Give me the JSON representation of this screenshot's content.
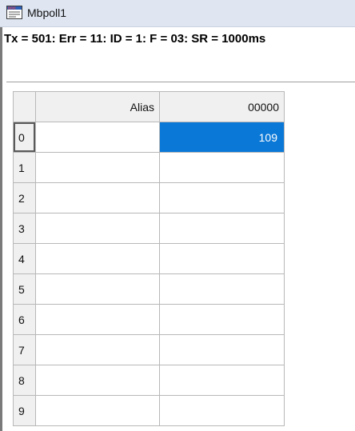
{
  "window": {
    "title": "Mbpoll1",
    "icon": "doc-window-icon"
  },
  "status": {
    "text": "Tx = 501: Err = 11: ID = 1: F = 03: SR = 1000ms"
  },
  "table": {
    "headers": {
      "alias": "Alias",
      "address": "00000"
    },
    "rows": [
      {
        "index": "0",
        "alias": "",
        "value": "109"
      },
      {
        "index": "1",
        "alias": "",
        "value": ""
      },
      {
        "index": "2",
        "alias": "",
        "value": ""
      },
      {
        "index": "3",
        "alias": "",
        "value": ""
      },
      {
        "index": "4",
        "alias": "",
        "value": ""
      },
      {
        "index": "5",
        "alias": "",
        "value": ""
      },
      {
        "index": "6",
        "alias": "",
        "value": ""
      },
      {
        "index": "7",
        "alias": "",
        "value": ""
      },
      {
        "index": "8",
        "alias": "",
        "value": ""
      },
      {
        "index": "9",
        "alias": "",
        "value": ""
      }
    ],
    "selected_row": 0
  },
  "colors": {
    "selection": "#0a78d7",
    "header_bg": "#f0f0f0",
    "titlebar_bg": "#dfe6f2"
  }
}
